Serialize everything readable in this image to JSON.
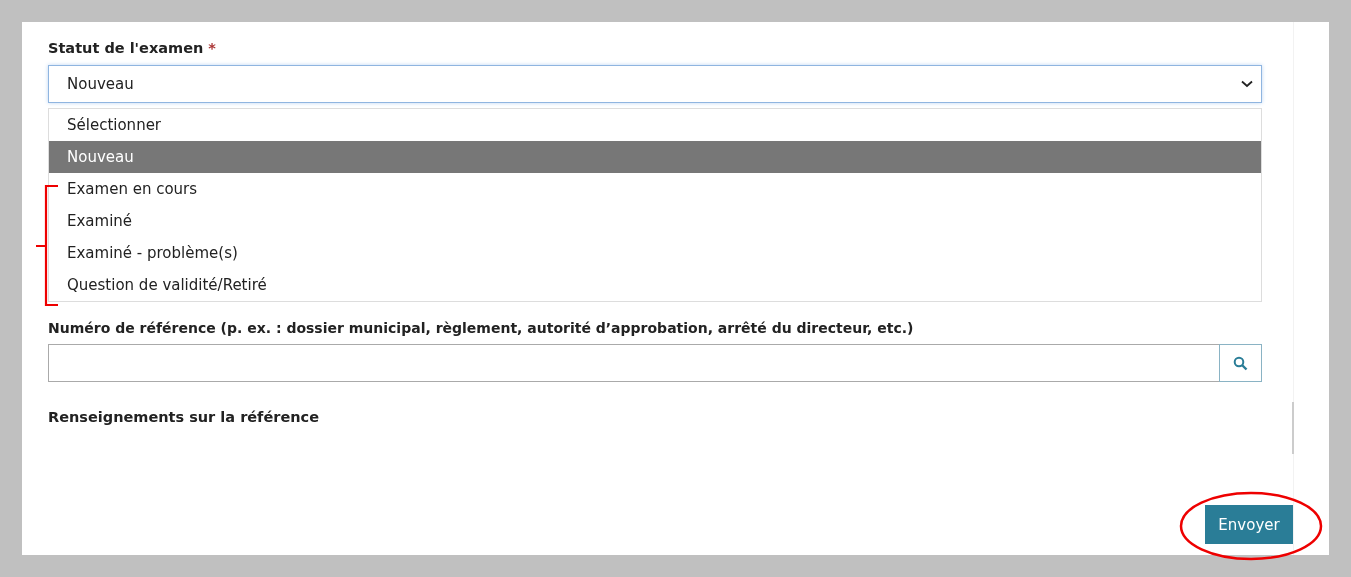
{
  "status_field": {
    "label": "Statut de l'examen",
    "required_mark": "*",
    "value": "Nouveau",
    "options": [
      {
        "label": "Sélectionner",
        "selected": false
      },
      {
        "label": "Nouveau",
        "selected": true
      },
      {
        "label": "Examen en cours",
        "selected": false
      },
      {
        "label": "Examiné",
        "selected": false
      },
      {
        "label": "Examiné - problème(s)",
        "selected": false
      },
      {
        "label": "Question de validité/Retiré",
        "selected": false
      }
    ]
  },
  "reference_field": {
    "label": "Numéro de référence (p. ex. : dossier municipal, règlement, autorité d’approbation, arrêté du directeur, etc.)"
  },
  "reference_info": {
    "heading": "Renseignements sur la référence"
  },
  "submit_button": "Envoyer"
}
